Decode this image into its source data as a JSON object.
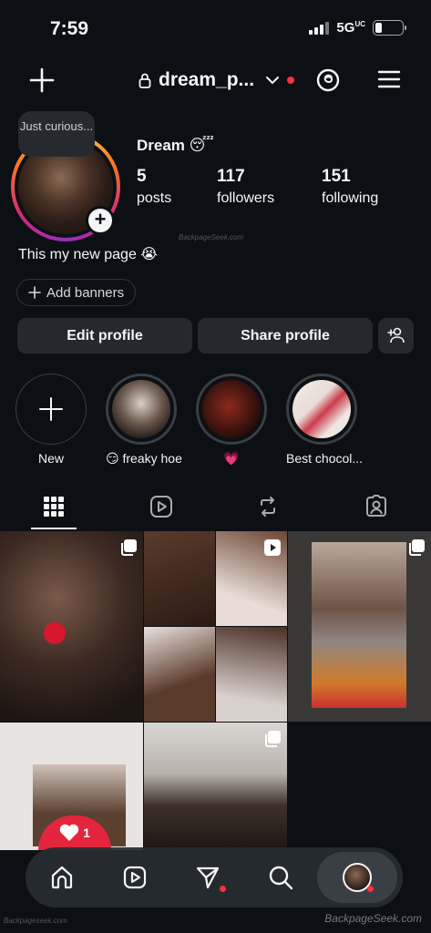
{
  "status": {
    "time": "7:59",
    "network": "5G",
    "network_sup": "UC"
  },
  "header": {
    "username": "dream_p...",
    "create_icon": "plus-icon",
    "threads_icon": "threads-icon",
    "menu_icon": "hamburger-menu-icon"
  },
  "profile": {
    "note": "Just curious...",
    "display_name": "Dream 😴",
    "stats": [
      {
        "value": "5",
        "label": "posts"
      },
      {
        "value": "117",
        "label": "followers"
      },
      {
        "value": "151",
        "label": "following"
      }
    ],
    "bio": "This my new page 😭",
    "watermark": "BackpageSeek.com",
    "add_banners": "Add banners",
    "edit_profile": "Edit profile",
    "share_profile": "Share profile"
  },
  "highlights": [
    {
      "label": "New"
    },
    {
      "label": "😏 freaky hoe"
    },
    {
      "label": "💗"
    },
    {
      "label": "Best chocol..."
    }
  ],
  "tabs": [
    "grid-icon",
    "reels-icon",
    "reposts-icon",
    "tagged-icon"
  ],
  "grid": {
    "posts": [
      {
        "type": "carousel"
      },
      {
        "type": "reel"
      },
      {
        "type": "carousel"
      },
      {
        "type": "photo",
        "like_count": "1"
      },
      {
        "type": "carousel"
      }
    ]
  },
  "bottom_nav": [
    "home-icon",
    "reels-icon",
    "direct-icon",
    "search-icon",
    "profile-avatar"
  ],
  "footer": {
    "watermark": "BackpageSeek.com",
    "small_watermark": "Backpageseek.com"
  }
}
